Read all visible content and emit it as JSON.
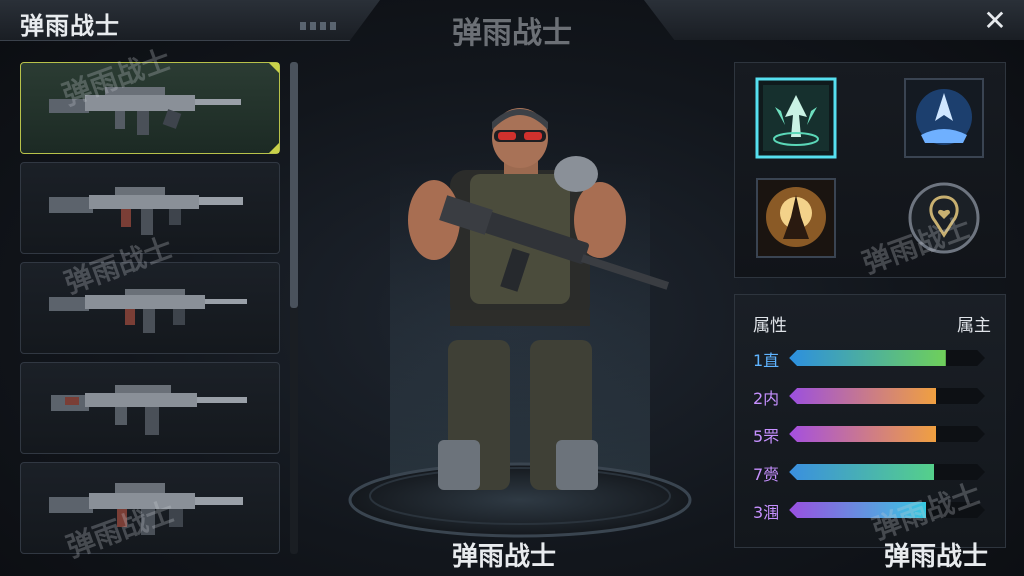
{
  "header": {
    "title": "弹雨战士",
    "center_title": "弹雨战士",
    "close_glyph": "✕"
  },
  "watermark": "弹雨战士",
  "weapons": [
    {
      "name": "assault-rifle-1",
      "selected": true
    },
    {
      "name": "assault-rifle-2",
      "selected": false
    },
    {
      "name": "assault-rifle-3",
      "selected": false
    },
    {
      "name": "assault-rifle-4",
      "selected": false
    },
    {
      "name": "assault-rifle-5",
      "selected": false
    }
  ],
  "skills": [
    {
      "icon": "upward-arrows-skill-icon",
      "active": true
    },
    {
      "icon": "blue-shield-skill-icon",
      "active": false
    },
    {
      "icon": "golden-burst-skill-icon",
      "active": false
    },
    {
      "icon": "location-heart-skill-icon",
      "active": false
    }
  ],
  "attributes": {
    "header_left": "属性",
    "header_right": "属主",
    "rows": [
      {
        "label": "1直",
        "value": 0.8,
        "from": "#2c8fe0",
        "to": "#6fd05a"
      },
      {
        "label": "2内",
        "value": 0.75,
        "from": "#9b4fe0",
        "to": "#f0a040"
      },
      {
        "label": "5罘",
        "value": 0.75,
        "from": "#a44fe0",
        "to": "#f0a040"
      },
      {
        "label": "7赍",
        "value": 0.74,
        "from": "#3a8fe0",
        "to": "#55d08a"
      },
      {
        "label": "3涠",
        "value": 0.7,
        "from": "#9a4fe0",
        "to": "#37c8e0"
      }
    ]
  },
  "bottom": {
    "center": "弹雨战士",
    "right": "弹雨战士"
  }
}
